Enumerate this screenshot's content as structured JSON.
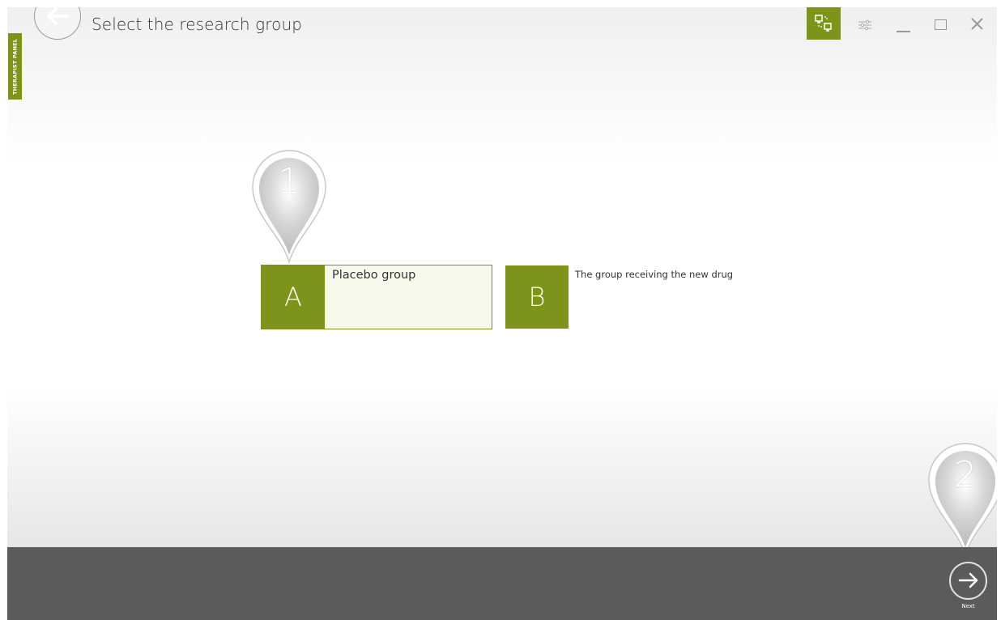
{
  "header": {
    "title": "Select the research group",
    "side_tab": "THERAPIST PANEL"
  },
  "toolbar": {
    "icons": [
      "network-icon",
      "settings-sliders-icon",
      "minimize-icon",
      "maximize-icon",
      "close-icon"
    ],
    "accent": "#7d9319"
  },
  "markers": [
    {
      "number": "1"
    },
    {
      "number": "2"
    }
  ],
  "options": [
    {
      "letter": "A",
      "label": "Placebo group",
      "selected": true
    },
    {
      "letter": "B",
      "label": "The group receiving the new drug",
      "selected": false
    }
  ],
  "footer": {
    "next_label": "Next",
    "bar_color": "#5b5b5b"
  }
}
